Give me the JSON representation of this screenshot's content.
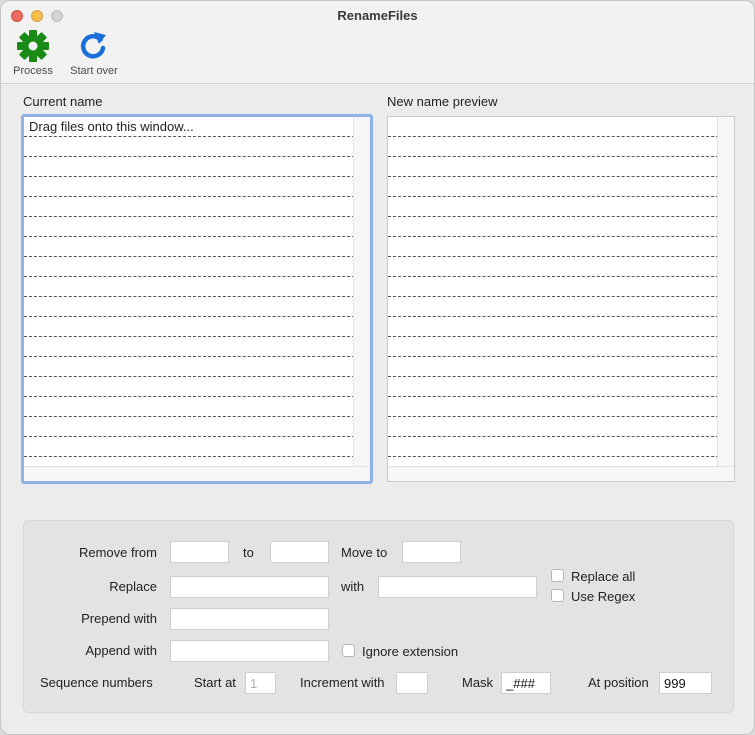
{
  "window": {
    "title": "RenameFiles"
  },
  "toolbar": {
    "process": {
      "label": "Process",
      "icon": "gear-icon",
      "color": "#1a8a17"
    },
    "start_over": {
      "label": "Start over",
      "icon": "refresh-icon",
      "color": "#1a6fd8"
    }
  },
  "lists": {
    "current": {
      "label": "Current name",
      "rows": [
        "Drag files onto this window...",
        "",
        "",
        "",
        "",
        "",
        "",
        "",
        "",
        "",
        "",
        "",
        "",
        "",
        "",
        "",
        "",
        ""
      ]
    },
    "preview": {
      "label": "New name preview",
      "rows": [
        "",
        "",
        "",
        "",
        "",
        "",
        "",
        "",
        "",
        "",
        "",
        "",
        "",
        "",
        "",
        "",
        "",
        ""
      ]
    }
  },
  "options": {
    "remove_from": {
      "label": "Remove from",
      "value": ""
    },
    "to": {
      "label": "to",
      "value": ""
    },
    "move_to": {
      "label": "Move to",
      "value": ""
    },
    "replace": {
      "label": "Replace",
      "value": ""
    },
    "with": {
      "label": "with",
      "value": ""
    },
    "replace_all": {
      "label": "Replace all",
      "checked": false
    },
    "use_regex": {
      "label": "Use Regex",
      "checked": false
    },
    "prepend": {
      "label": "Prepend with",
      "value": ""
    },
    "append": {
      "label": "Append with",
      "value": ""
    },
    "ignore_extension": {
      "label": "Ignore extension",
      "checked": false
    },
    "sequence": {
      "label": "Sequence numbers",
      "start_at": {
        "label": "Start at",
        "value": "1"
      },
      "increment": {
        "label": "Increment with",
        "value": ""
      },
      "mask": {
        "label": "Mask",
        "value": "_###"
      },
      "at_position": {
        "label": "At position",
        "value": "999"
      }
    }
  }
}
